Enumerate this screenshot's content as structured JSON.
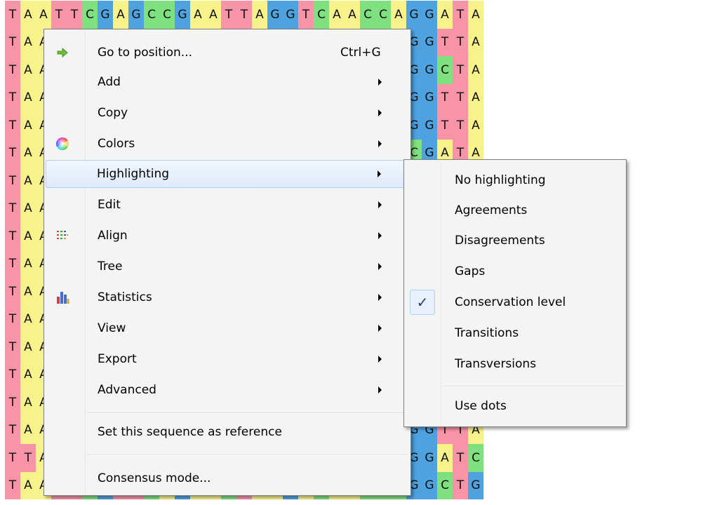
{
  "colors": {
    "A": "#f8f28a",
    "C": "#7fe07f",
    "G": "#4ea2e0",
    "T": "#f794a8",
    "other": "#ffffff"
  },
  "sequences": [
    "TAATTCGAGCCGAATTAGGTCAACCAGGATA",
    "TAATTCGAGCCGAATTAGGTCAACCTGGTTA",
    "TAATTCGAGCCGAATTAGGTCAACCAGGCTA",
    "TAATTCGAGCCGAATTAGGTCAACCAGGTTA",
    "TAATTCGAGCCGAATTAGGCCAACCAGGTTA",
    "TAATTCGAGCCGAATTAGCTCAACCTCGATA",
    "TAATTCGAGCCGAATTAGGTCAACCAGGATA",
    "TAATTCGAGCCGAATTAGGTCAACCAGGCTA",
    "TAATTCGAGCCGAATTAGGTCAACCAGGCTA",
    "TAATTCGAGCCGAATTAGGTCAACCAGGGTA",
    "TAATTCGAGCCGAATTAGGTCAACCAGGGTA",
    "TAATTCGAGCCGAATTAGGTCAACCAGGGTA",
    "TAATTCGAGCCGAATTAGGTCAACCAGGGTA",
    "TAATTCGAGCCGAATTAGGTCAACCAGGTTA",
    "TAATTCGAGCCGAATTAGGTCAACCAGGTTA",
    "TAATTCGAGCCGAATTAGGACAACCTGGTTA",
    "TTATTCGAGCCGAATTAGGACAACCAGGATC",
    "TAATTCGTTCAGAACTAAGACAACCCGGCTG"
  ],
  "menu": {
    "items": [
      {
        "label": "Go to position...",
        "shortcut": "Ctrl+G",
        "icon": "arrow-right-icon",
        "submenu": false
      },
      {
        "label": "Add",
        "submenu": true
      },
      {
        "label": "Copy",
        "submenu": true
      },
      {
        "label": "Colors",
        "icon": "color-wheel-icon",
        "submenu": true
      },
      {
        "label": "Highlighting",
        "submenu": true,
        "highlighted": true
      },
      {
        "label": "Edit",
        "submenu": true
      },
      {
        "label": "Align",
        "icon": "align-icon",
        "submenu": true
      },
      {
        "label": "Tree",
        "submenu": true
      },
      {
        "label": "Statistics",
        "icon": "bar-chart-icon",
        "submenu": true
      },
      {
        "label": "View",
        "submenu": true
      },
      {
        "label": "Export",
        "submenu": true
      },
      {
        "label": "Advanced",
        "submenu": true
      },
      {
        "label": "Set this sequence as reference"
      },
      {
        "label": "Consensus mode..."
      }
    ]
  },
  "submenu": {
    "items": [
      {
        "label": "No highlighting"
      },
      {
        "label": "Agreements"
      },
      {
        "label": "Disagreements"
      },
      {
        "label": "Gaps"
      },
      {
        "label": "Conservation level",
        "checked": true
      },
      {
        "label": "Transitions"
      },
      {
        "label": "Transversions"
      },
      {
        "label": "Use dots"
      }
    ],
    "check_mark": "✓"
  }
}
